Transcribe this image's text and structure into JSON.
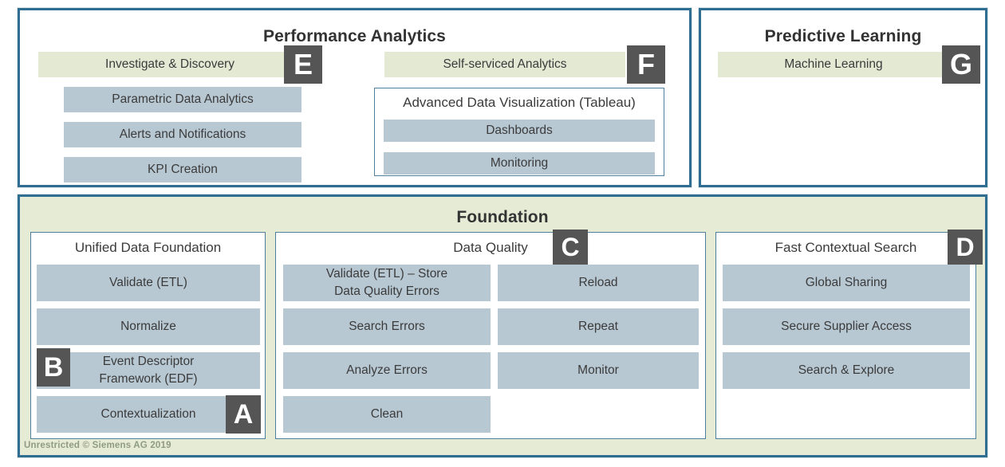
{
  "diagram": {
    "title_performance": "Performance Analytics",
    "title_predictive": "Predictive Learning",
    "title_foundation": "Foundation",
    "footer": "Unrestricted © Siemens AG 2019",
    "colors": {
      "border": "#2f6e91",
      "bar": "#b8c8d3",
      "highlight": "#e4e9d4",
      "panel_green": "#e6ebd6",
      "badge": "#555555",
      "text": "#3b3b3b"
    }
  },
  "performance_analytics": {
    "title": "Performance Analytics",
    "left_column": [
      {
        "label": "Investigate & Discovery",
        "highlight": true
      },
      {
        "label": "Parametric Data Analytics",
        "highlight": false
      },
      {
        "label": "Alerts and Notifications",
        "highlight": false
      },
      {
        "label": "KPI Creation",
        "highlight": false
      }
    ],
    "right_column": [
      {
        "label": "Self-serviced Analytics",
        "highlight": true
      }
    ],
    "sub_panel": {
      "title": "Advanced Data Visualization (Tableau)",
      "items": [
        {
          "label": "Dashboards"
        },
        {
          "label": "Monitoring"
        }
      ]
    }
  },
  "predictive_learning": {
    "title": "Predictive Learning",
    "items": [
      {
        "label": "Machine Learning",
        "highlight": true
      }
    ]
  },
  "foundation": {
    "title": "Foundation",
    "unified_data_foundation": {
      "title": "Unified Data Foundation",
      "items": [
        {
          "label": "Validate (ETL)"
        },
        {
          "label": "Normalize"
        },
        {
          "label": "Event Descriptor\nFramework (EDF)"
        },
        {
          "label": "Contextualization"
        }
      ]
    },
    "data_quality": {
      "title": "Data Quality",
      "left_items": [
        {
          "label": "Validate (ETL) – Store\nData Quality Errors"
        },
        {
          "label": "Search Errors"
        },
        {
          "label": "Analyze Errors"
        },
        {
          "label": "Clean"
        }
      ],
      "right_items": [
        {
          "label": "Reload"
        },
        {
          "label": "Repeat"
        },
        {
          "label": "Monitor"
        }
      ]
    },
    "fast_contextual_search": {
      "title": "Fast Contextual Search",
      "items": [
        {
          "label": "Global Sharing"
        },
        {
          "label": "Secure Supplier Access"
        },
        {
          "label": "Search & Explore"
        }
      ]
    }
  },
  "badges": {
    "a": "A",
    "b": "B",
    "c": "C",
    "d": "D",
    "e": "E",
    "f": "F",
    "g": "G"
  }
}
